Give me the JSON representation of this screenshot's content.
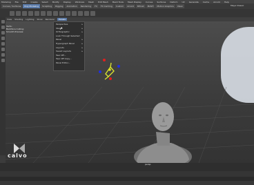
{
  "menubar": {
    "items": [
      "Modeling",
      "File",
      "Edit",
      "Create",
      "Select",
      "Modify",
      "Display",
      "Windows",
      "Mesh",
      "Edit Mesh",
      "Mesh Tools",
      "Mesh Display",
      "Curves",
      "Surfaces",
      "Deform",
      "UV",
      "Generate",
      "Cache",
      "Arnold",
      "Help"
    ]
  },
  "shelf": {
    "tabs": [
      "Curves / Surfaces",
      "Poly Modeling",
      "Sculpting",
      "Rigging",
      "Animation",
      "Rendering",
      "FX",
      "FX Caching",
      "Custom",
      "Arnold",
      "Bifrost",
      "MASH",
      "Motion Graphics",
      "XGen"
    ],
    "active_tab": "Poly Modeling",
    "workspace": "Maya Classic"
  },
  "panel_menu": {
    "items": [
      "View",
      "Shading",
      "Lighting",
      "Show",
      "Renderer",
      "Panels"
    ],
    "open": "Panels"
  },
  "hud": {
    "line1": "Verts:",
    "line2": "Backface Culling:",
    "line3": "Smooth Preview:"
  },
  "dropdown": {
    "items": [
      {
        "label": "Perspective",
        "sub": true
      },
      {
        "label": "Stereo",
        "sub": true
      },
      {
        "label": "Orthographic",
        "sub": true
      },
      {
        "label": "Look Through Selected",
        "sub": false
      },
      {
        "label": "Panel",
        "sub": true
      },
      {
        "label": "Hypergraph Panel",
        "sub": true
      },
      {
        "label": "Layouts",
        "sub": true
      },
      {
        "label": "Saved Layouts",
        "sub": true
      },
      {
        "label": "Tear Off...",
        "sub": false
      },
      {
        "label": "Tear Off Copy...",
        "sub": false
      },
      {
        "label": "Panel Editor...",
        "sub": false
      }
    ]
  },
  "viewport": {
    "camera": "persp"
  },
  "logo": {
    "text": "calvo"
  },
  "colors": {
    "accent": "#5a7aa8",
    "manip_red": "#e02020",
    "manip_blue": "#2030e0",
    "manip_yellow": "#e0e020",
    "bust": "#8a8a8a"
  }
}
